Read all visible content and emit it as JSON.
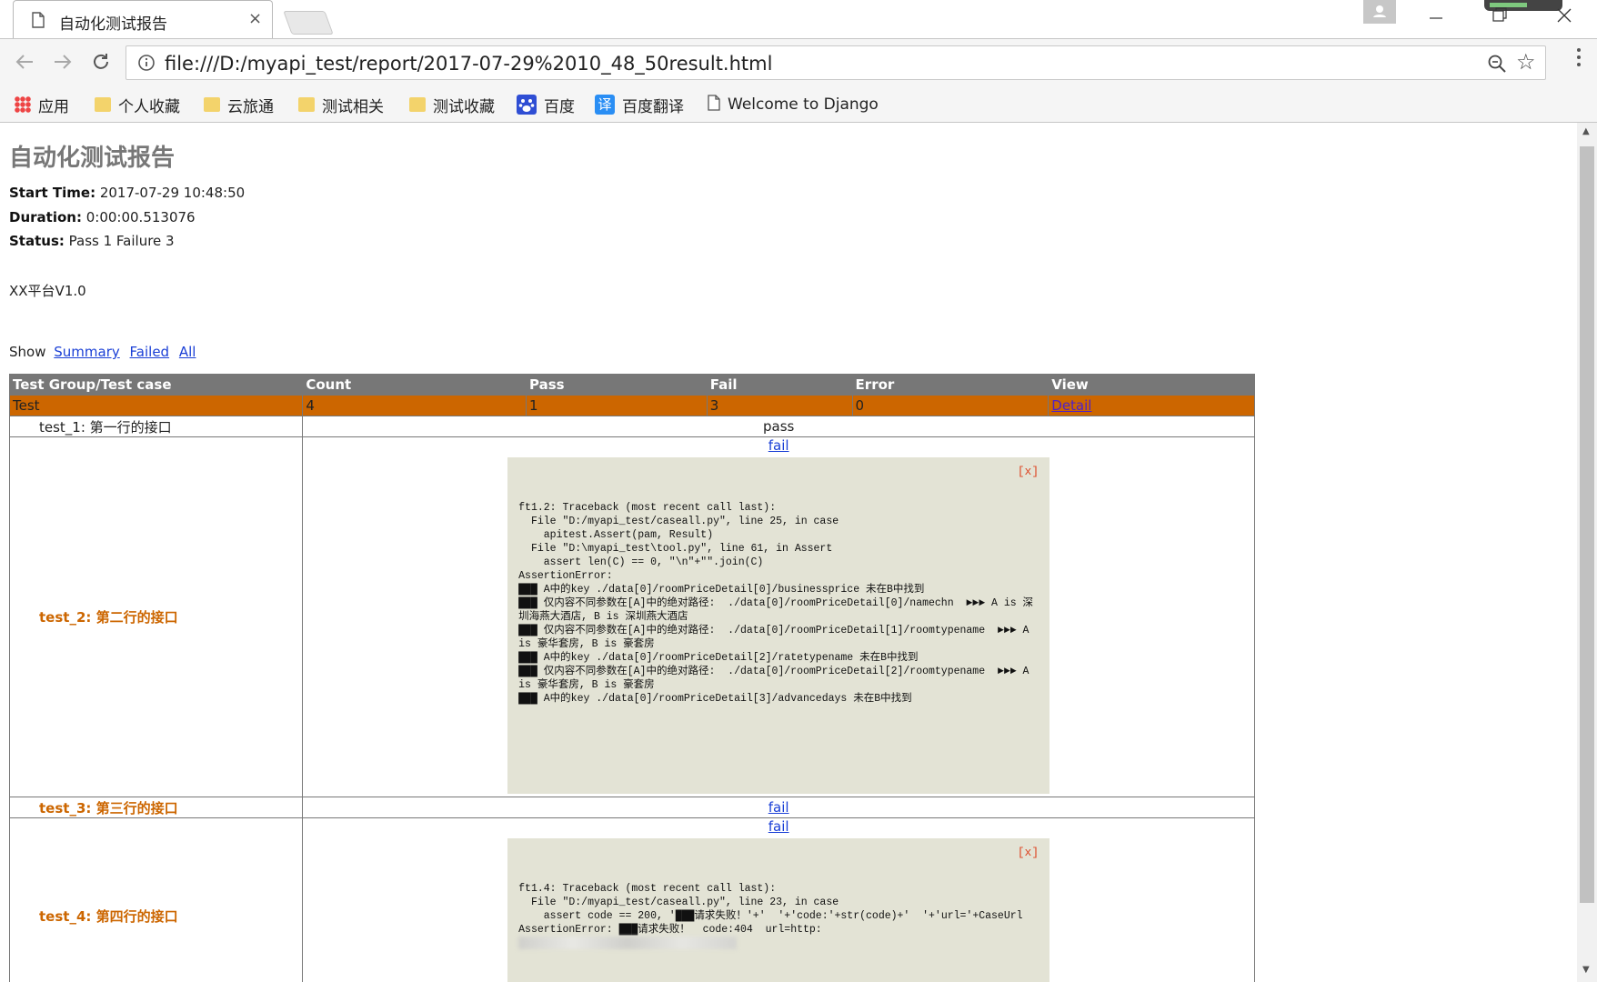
{
  "browser": {
    "tab_title": "自动化测试报告",
    "tab_close": "×",
    "url": "file:///D:/myapi_test/report/2017-07-29%2010_48_50result.html",
    "battery_level": 0.55,
    "bookmarks": [
      {
        "label": "应用",
        "icon": "apps-icon"
      },
      {
        "label": "个人收藏",
        "icon": "folder-icon"
      },
      {
        "label": "云旅通",
        "icon": "folder-icon"
      },
      {
        "label": "测试相关",
        "icon": "folder-icon"
      },
      {
        "label": "测试收藏",
        "icon": "folder-icon"
      },
      {
        "label": "百度",
        "icon": "baidu-paw-icon"
      },
      {
        "label": "百度翻译",
        "icon": "baidu-translate-icon",
        "glyph": "译"
      },
      {
        "label": "Welcome to Django",
        "icon": "page-icon"
      }
    ]
  },
  "report": {
    "title": "自动化测试报告",
    "start_time_label": "Start Time:",
    "start_time": "2017-07-29 10:48:50",
    "duration_label": "Duration:",
    "duration": "0:00:00.513076",
    "status_label": "Status:",
    "status": "Pass 1 Failure 3",
    "description": "XX平台V1.0",
    "show_label": "Show",
    "filters": [
      "Summary",
      "Failed",
      "All"
    ],
    "table": {
      "headers": [
        "Test Group/Test case",
        "Count",
        "Pass",
        "Fail",
        "Error",
        "View"
      ],
      "class_row": {
        "name": "Test",
        "count": "4",
        "pass": "1",
        "fail": "3",
        "error": "0",
        "view": "Detail"
      },
      "cases": [
        {
          "name": "test_1: 第一行的接口",
          "status": "pass"
        },
        {
          "name": "test_2: 第二行的接口",
          "status": "fail",
          "close": "[x]",
          "trace": "ft1.2: Traceback (most recent call last):\n  File \"D:/myapi_test/caseall.py\", line 25, in case\n    apitest.Assert(pam, Result)\n  File \"D:\\myapi_test\\tool.py\", line 61, in Assert\n    assert len(C) == 0, \"\\n\"+\"\".join(C)\nAssertionError:\n███ A中的key ./data[0]/roomPriceDetail[0]/businessprice 未在B中找到\n███ 仅内容不同参数在[A]中的绝对路径:  ./data[0]/roomPriceDetail[0]/namechn  ►►► A is 深圳海燕大酒店, B is 深圳燕大酒店\n███ 仅内容不同参数在[A]中的绝对路径:  ./data[0]/roomPriceDetail[1]/roomtypename  ►►► A is 豪华套房, B is 豪套房\n███ A中的key ./data[0]/roomPriceDetail[2]/ratetypename 未在B中找到\n███ 仅内容不同参数在[A]中的绝对路径:  ./data[0]/roomPriceDetail[2]/roomtypename  ►►► A is 豪华套房, B is 豪套房\n███ A中的key ./data[0]/roomPriceDetail[3]/advancedays 未在B中找到"
        },
        {
          "name": "test_3: 第三行的接口",
          "status": "fail"
        },
        {
          "name": "test_4: 第四行的接口",
          "status": "fail",
          "close": "[x]",
          "trace": "ft1.4: Traceback (most recent call last):\n  File \"D:/myapi_test/caseall.py\", line 23, in case\n    assert code == 200, '███请求失败！'+'  '+'code:'+str(code)+'  '+'url='+CaseUrl\nAssertionError: ███请求失败！  code:404  url=http:"
        }
      ]
    }
  }
}
